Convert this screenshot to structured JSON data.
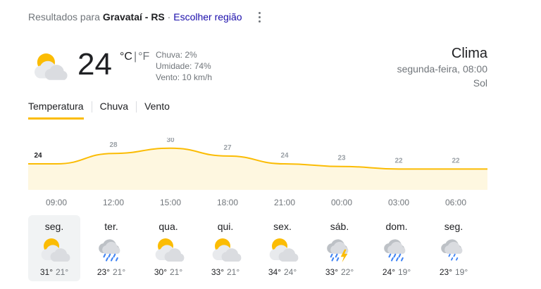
{
  "header": {
    "prefix": "Resultados para",
    "location": "Gravataí - RS",
    "separator": "·",
    "choose_region": "Escolher região"
  },
  "current": {
    "temperature": "24",
    "unit_c": "°C",
    "unit_sep": "|",
    "unit_f": "°F",
    "icon": "partly-cloudy-sun-icon",
    "chuva": "Chuva: 2%",
    "umidade": "Umidade: 74%",
    "vento": "Vento: 10 km/h"
  },
  "summary": {
    "title": "Clima",
    "when": "segunda-feira, 08:00",
    "condition": "Sol"
  },
  "tabs": [
    {
      "label": "Temperatura",
      "active": true
    },
    {
      "label": "Chuva",
      "active": false
    },
    {
      "label": "Vento",
      "active": false
    }
  ],
  "colors": {
    "accent": "#fbbc04",
    "chart_fill": "#fef7e0",
    "link": "#1a0dab",
    "sun": "#fbbc04",
    "cloud": "#dadce0",
    "rain": "#4285f4",
    "bolt": "#fbbc04"
  },
  "chart_data": {
    "type": "area",
    "x": [
      "08:00",
      "09:00",
      "12:00",
      "15:00",
      "18:00",
      "21:00",
      "00:00",
      "03:00",
      "06:00",
      "07:00"
    ],
    "values": [
      24,
      24,
      28,
      30,
      27,
      24,
      23,
      22,
      22,
      22
    ],
    "labeled": [
      {
        "x": "08:00",
        "label": "24"
      },
      {
        "x": "12:00",
        "label": "28"
      },
      {
        "x": "15:00",
        "label": "30"
      },
      {
        "x": "18:00",
        "label": "27"
      },
      {
        "x": "21:00",
        "label": "24"
      },
      {
        "x": "00:00",
        "label": "23"
      },
      {
        "x": "03:00",
        "label": "22"
      },
      {
        "x": "06:00",
        "label": "22"
      }
    ],
    "time_ticks": [
      "09:00",
      "12:00",
      "15:00",
      "18:00",
      "21:00",
      "00:00",
      "03:00",
      "06:00"
    ],
    "ylim": [
      14,
      34
    ]
  },
  "days": [
    {
      "name": "seg.",
      "icon": "partly-cloudy-sun-icon",
      "hi": "31°",
      "lo": "21°",
      "selected": true
    },
    {
      "name": "ter.",
      "icon": "rain-icon",
      "hi": "23°",
      "lo": "21°",
      "selected": false
    },
    {
      "name": "qua.",
      "icon": "partly-cloudy-sun-icon",
      "hi": "30°",
      "lo": "21°",
      "selected": false
    },
    {
      "name": "qui.",
      "icon": "partly-cloudy-sun-icon",
      "hi": "33°",
      "lo": "21°",
      "selected": false
    },
    {
      "name": "sex.",
      "icon": "partly-cloudy-sun-icon",
      "hi": "34°",
      "lo": "24°",
      "selected": false
    },
    {
      "name": "sáb.",
      "icon": "thunderstorm-icon",
      "hi": "33°",
      "lo": "22°",
      "selected": false
    },
    {
      "name": "dom.",
      "icon": "rain-icon",
      "hi": "24°",
      "lo": "19°",
      "selected": false
    },
    {
      "name": "seg.",
      "icon": "light-rain-icon",
      "hi": "23°",
      "lo": "19°",
      "selected": false
    }
  ]
}
